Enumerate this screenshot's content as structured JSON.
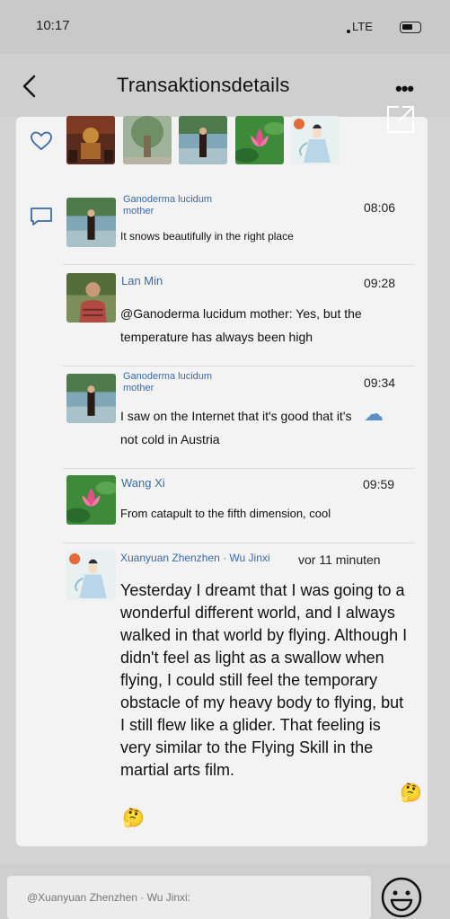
{
  "status": {
    "time": "10:17",
    "network": "LTE"
  },
  "header": {
    "title": "Transaktionsdetails",
    "more": "•••"
  },
  "likes": {
    "thumbs": [
      {
        "icon": "buddha-statue-avatar"
      },
      {
        "icon": "tree-avatar"
      },
      {
        "icon": "lakeside-person-avatar"
      },
      {
        "icon": "pink-lotus-avatar"
      },
      {
        "icon": "fairy-drawing-avatar"
      }
    ]
  },
  "comments": [
    {
      "name": "Ganoderma lucidum mother",
      "time": "08:06",
      "text": "It snows beautifully in the right place"
    },
    {
      "name": "Lan Min",
      "time": "09:28",
      "text": "@Ganoderma lucidum mother: Yes, but the temperature has always been high"
    },
    {
      "name": "Ganoderma lucidum mother",
      "time": "09:34",
      "text": "I saw on the Internet that it's good that it's not cold in Austria"
    },
    {
      "name": "Wang Xi",
      "time": "09:59",
      "text": "From catapult to the fifth dimension, cool"
    },
    {
      "name": "Xuanyuan Zhenzhen · Wu Jinxi",
      "time": "vor 11 minuten",
      "text": "Yesterday I dreamt that I was going to a wonderful different world, and I always walked in that world by flying. Although I didn't feel as light as a swallow when flying, I could still feel the temporary obstacle of my heavy body to flying, but I still flew like a glider. That feeling is very similar to the Flying Skill in the martial arts film."
    }
  ],
  "input": {
    "placeholder": "@Xuanyuan Zhenzhen · Wu Jinxi:"
  }
}
